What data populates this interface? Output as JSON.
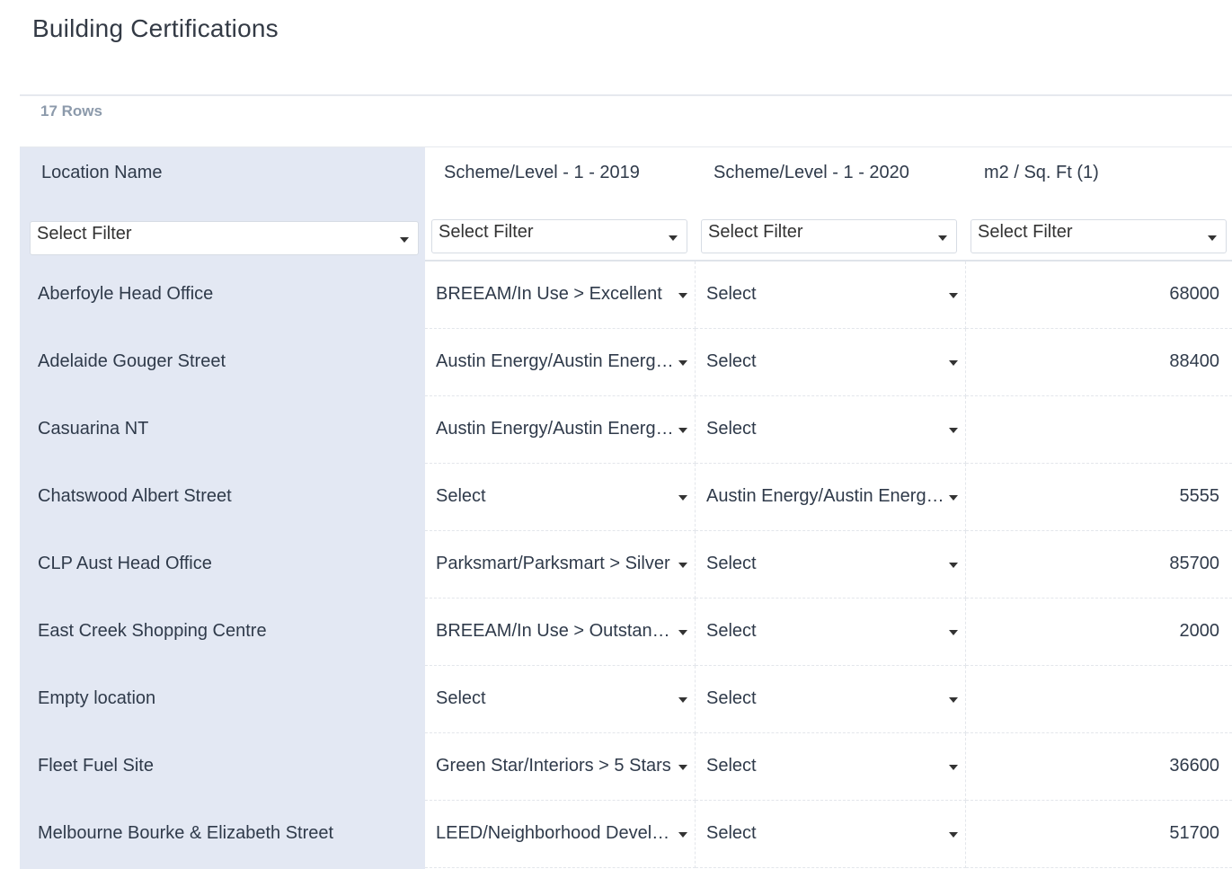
{
  "title": "Building Certifications",
  "row_count": "17 Rows",
  "columns": [
    {
      "label": "Location Name",
      "filter": "Select Filter"
    },
    {
      "label": "Scheme/Level - 1 - 2019",
      "filter": "Select Filter"
    },
    {
      "label": "Scheme/Level - 1 - 2020",
      "filter": "Select Filter"
    },
    {
      "label": "m2 / Sq. Ft (1)",
      "filter": "Select Filter"
    }
  ],
  "rows": [
    {
      "name": "Aberfoyle Head Office",
      "s2019": "BREEAM/In Use > Excellent",
      "s2020": "Select",
      "area": "68000"
    },
    {
      "name": "Adelaide Gouger Street",
      "s2019": "Austin Energy/Austin Energy Green Building",
      "s2020": "Select",
      "area": "88400"
    },
    {
      "name": "Casuarina NT",
      "s2019": "Austin Energy/Austin Energy Green Building",
      "s2020": "Select",
      "area": ""
    },
    {
      "name": "Chatswood Albert Street",
      "s2019": "Select",
      "s2020": "Austin Energy/Austin Energy Green Building",
      "area": "5555"
    },
    {
      "name": "CLP Aust Head Office",
      "s2019": "Parksmart/Parksmart > Silver",
      "s2020": "Select",
      "area": "85700"
    },
    {
      "name": "East Creek Shopping Centre",
      "s2019": "BREEAM/In Use > Outstanding",
      "s2020": "Select",
      "area": "2000"
    },
    {
      "name": "Empty location",
      "s2019": "Select",
      "s2020": "Select",
      "area": ""
    },
    {
      "name": "Fleet Fuel Site",
      "s2019": "Green Star/Interiors > 5 Stars",
      "s2020": "Select",
      "area": "36600"
    },
    {
      "name": "Melbourne Bourke & Elizabeth Street",
      "s2019": "LEED/Neighborhood Development",
      "s2020": "Select",
      "area": "51700"
    }
  ],
  "colors": {
    "pinned_bg": "#e3e8f3",
    "text": "#2f3a4a",
    "muted": "#8c9aab"
  },
  "icons": {
    "dropdown": "caret-down-icon"
  }
}
